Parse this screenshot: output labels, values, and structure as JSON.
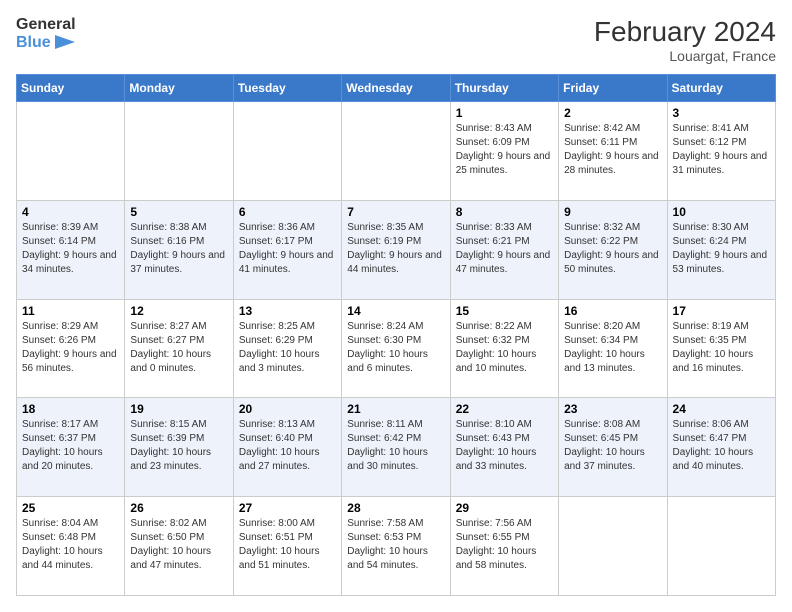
{
  "header": {
    "logo_line1": "General",
    "logo_line2": "Blue",
    "month_year": "February 2024",
    "location": "Louargat, France"
  },
  "days_of_week": [
    "Sunday",
    "Monday",
    "Tuesday",
    "Wednesday",
    "Thursday",
    "Friday",
    "Saturday"
  ],
  "weeks": [
    [
      {
        "day": "",
        "info": ""
      },
      {
        "day": "",
        "info": ""
      },
      {
        "day": "",
        "info": ""
      },
      {
        "day": "",
        "info": ""
      },
      {
        "day": "1",
        "info": "Sunrise: 8:43 AM\nSunset: 6:09 PM\nDaylight: 9 hours and 25 minutes."
      },
      {
        "day": "2",
        "info": "Sunrise: 8:42 AM\nSunset: 6:11 PM\nDaylight: 9 hours and 28 minutes."
      },
      {
        "day": "3",
        "info": "Sunrise: 8:41 AM\nSunset: 6:12 PM\nDaylight: 9 hours and 31 minutes."
      }
    ],
    [
      {
        "day": "4",
        "info": "Sunrise: 8:39 AM\nSunset: 6:14 PM\nDaylight: 9 hours and 34 minutes."
      },
      {
        "day": "5",
        "info": "Sunrise: 8:38 AM\nSunset: 6:16 PM\nDaylight: 9 hours and 37 minutes."
      },
      {
        "day": "6",
        "info": "Sunrise: 8:36 AM\nSunset: 6:17 PM\nDaylight: 9 hours and 41 minutes."
      },
      {
        "day": "7",
        "info": "Sunrise: 8:35 AM\nSunset: 6:19 PM\nDaylight: 9 hours and 44 minutes."
      },
      {
        "day": "8",
        "info": "Sunrise: 8:33 AM\nSunset: 6:21 PM\nDaylight: 9 hours and 47 minutes."
      },
      {
        "day": "9",
        "info": "Sunrise: 8:32 AM\nSunset: 6:22 PM\nDaylight: 9 hours and 50 minutes."
      },
      {
        "day": "10",
        "info": "Sunrise: 8:30 AM\nSunset: 6:24 PM\nDaylight: 9 hours and 53 minutes."
      }
    ],
    [
      {
        "day": "11",
        "info": "Sunrise: 8:29 AM\nSunset: 6:26 PM\nDaylight: 9 hours and 56 minutes."
      },
      {
        "day": "12",
        "info": "Sunrise: 8:27 AM\nSunset: 6:27 PM\nDaylight: 10 hours and 0 minutes."
      },
      {
        "day": "13",
        "info": "Sunrise: 8:25 AM\nSunset: 6:29 PM\nDaylight: 10 hours and 3 minutes."
      },
      {
        "day": "14",
        "info": "Sunrise: 8:24 AM\nSunset: 6:30 PM\nDaylight: 10 hours and 6 minutes."
      },
      {
        "day": "15",
        "info": "Sunrise: 8:22 AM\nSunset: 6:32 PM\nDaylight: 10 hours and 10 minutes."
      },
      {
        "day": "16",
        "info": "Sunrise: 8:20 AM\nSunset: 6:34 PM\nDaylight: 10 hours and 13 minutes."
      },
      {
        "day": "17",
        "info": "Sunrise: 8:19 AM\nSunset: 6:35 PM\nDaylight: 10 hours and 16 minutes."
      }
    ],
    [
      {
        "day": "18",
        "info": "Sunrise: 8:17 AM\nSunset: 6:37 PM\nDaylight: 10 hours and 20 minutes."
      },
      {
        "day": "19",
        "info": "Sunrise: 8:15 AM\nSunset: 6:39 PM\nDaylight: 10 hours and 23 minutes."
      },
      {
        "day": "20",
        "info": "Sunrise: 8:13 AM\nSunset: 6:40 PM\nDaylight: 10 hours and 27 minutes."
      },
      {
        "day": "21",
        "info": "Sunrise: 8:11 AM\nSunset: 6:42 PM\nDaylight: 10 hours and 30 minutes."
      },
      {
        "day": "22",
        "info": "Sunrise: 8:10 AM\nSunset: 6:43 PM\nDaylight: 10 hours and 33 minutes."
      },
      {
        "day": "23",
        "info": "Sunrise: 8:08 AM\nSunset: 6:45 PM\nDaylight: 10 hours and 37 minutes."
      },
      {
        "day": "24",
        "info": "Sunrise: 8:06 AM\nSunset: 6:47 PM\nDaylight: 10 hours and 40 minutes."
      }
    ],
    [
      {
        "day": "25",
        "info": "Sunrise: 8:04 AM\nSunset: 6:48 PM\nDaylight: 10 hours and 44 minutes."
      },
      {
        "day": "26",
        "info": "Sunrise: 8:02 AM\nSunset: 6:50 PM\nDaylight: 10 hours and 47 minutes."
      },
      {
        "day": "27",
        "info": "Sunrise: 8:00 AM\nSunset: 6:51 PM\nDaylight: 10 hours and 51 minutes."
      },
      {
        "day": "28",
        "info": "Sunrise: 7:58 AM\nSunset: 6:53 PM\nDaylight: 10 hours and 54 minutes."
      },
      {
        "day": "29",
        "info": "Sunrise: 7:56 AM\nSunset: 6:55 PM\nDaylight: 10 hours and 58 minutes."
      },
      {
        "day": "",
        "info": ""
      },
      {
        "day": "",
        "info": ""
      }
    ]
  ]
}
